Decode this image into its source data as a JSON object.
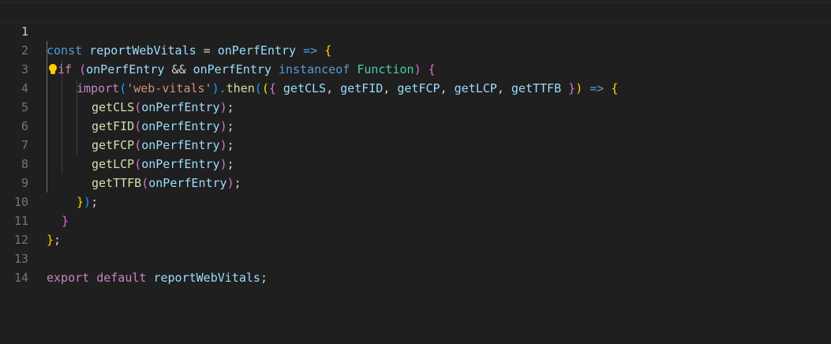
{
  "editor": {
    "lines": [
      {
        "number": "1",
        "tokens": [
          "const",
          " ",
          "reportWebVitals",
          " = ",
          "onPerfEntry",
          " ",
          "=>",
          " ",
          "{"
        ]
      },
      {
        "number": "2",
        "tokens": [
          "if",
          " ",
          "(",
          "onPerfEntry",
          " && ",
          "onPerfEntry",
          " ",
          "instanceof",
          " ",
          "Function",
          ")",
          " ",
          "{"
        ]
      },
      {
        "number": "3",
        "tokens": [
          "import",
          "(",
          "'web-vitals'",
          ").",
          "then",
          "(",
          "(",
          "{",
          " ",
          "getCLS",
          ", ",
          "getFID",
          ", ",
          "getFCP",
          ", ",
          "getLCP",
          ", ",
          "getTTFB",
          " ",
          "}",
          ")",
          " ",
          "=>",
          " ",
          "{"
        ]
      },
      {
        "number": "4",
        "tokens": [
          "getCLS",
          "(",
          "onPerfEntry",
          ")",
          ";"
        ]
      },
      {
        "number": "5",
        "tokens": [
          "getFID",
          "(",
          "onPerfEntry",
          ")",
          ";"
        ]
      },
      {
        "number": "6",
        "tokens": [
          "getFCP",
          "(",
          "onPerfEntry",
          ")",
          ";"
        ]
      },
      {
        "number": "7",
        "tokens": [
          "getLCP",
          "(",
          "onPerfEntry",
          ")",
          ";"
        ]
      },
      {
        "number": "8",
        "tokens": [
          "getTTFB",
          "(",
          "onPerfEntry",
          ")",
          ";"
        ]
      },
      {
        "number": "9",
        "tokens": [
          "}",
          ")",
          ";"
        ]
      },
      {
        "number": "10",
        "tokens": [
          "}"
        ]
      },
      {
        "number": "11",
        "tokens": [
          "}",
          ";"
        ]
      },
      {
        "number": "12",
        "tokens": []
      },
      {
        "number": "13",
        "tokens": [
          "export",
          " ",
          "default",
          " ",
          "reportWebVitals",
          ";"
        ]
      },
      {
        "number": "14",
        "tokens": []
      }
    ]
  },
  "colors": {
    "background": "#1f1f1f",
    "keyword_blue": "#569cd6",
    "keyword_purple": "#c586c0",
    "variable": "#9cdcfe",
    "function": "#dcdcaa",
    "type": "#4ec9b0",
    "string": "#ce9178",
    "bracket_gold": "#ffd700",
    "bracket_pink": "#da70d6",
    "bracket_blue": "#179fff"
  },
  "icons": {
    "line2": "lightbulb-icon"
  }
}
